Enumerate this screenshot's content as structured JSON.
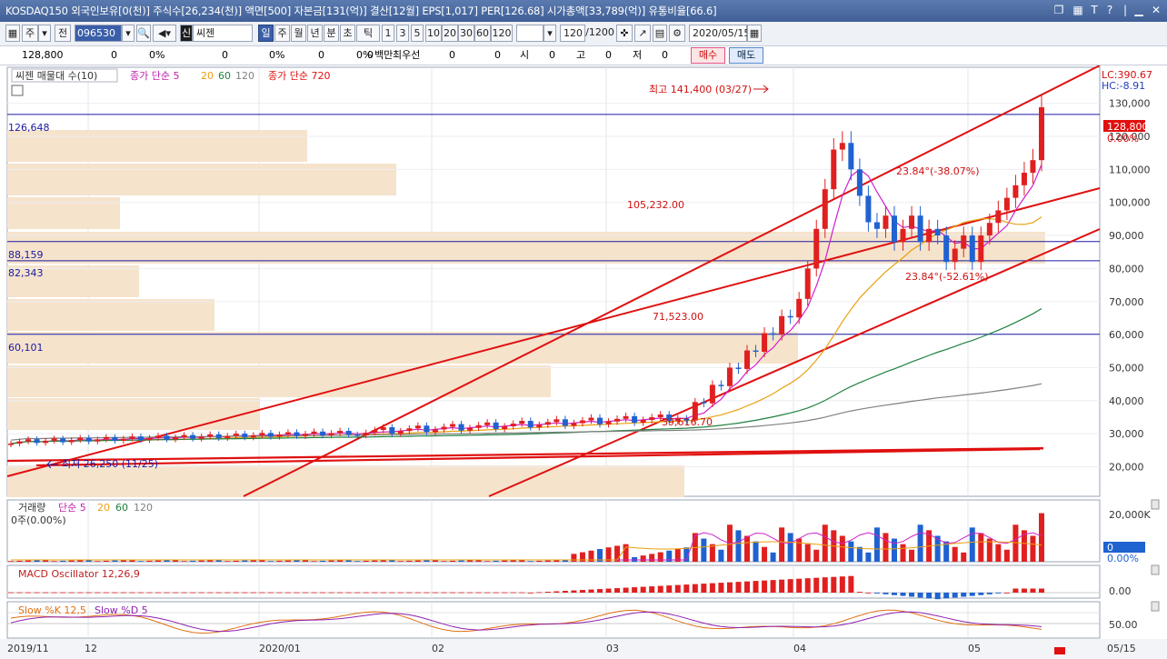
{
  "titlebar": {
    "text": "KOSDAQ150 외국인보유[0(천)] 주식수[26,234(천)] 액면[500] 자본금[131(억)] 결산[12월] EPS[1,017] PER[126.68] 시가총액[33,789(억)] 유통비율[66.6]"
  },
  "toolbar": {
    "buttons": [
      "주",
      "전"
    ],
    "code": "096530",
    "name": "씨젠",
    "name_badge": "신",
    "periods": [
      "일",
      "주",
      "월",
      "년",
      "분",
      "초",
      "틱"
    ],
    "intervals": [
      "1",
      "3",
      "5",
      "10",
      "20",
      "30",
      "60",
      "120"
    ],
    "count": "120",
    "count_total": "/1200",
    "date": "2020/05/15"
  },
  "infobar": {
    "price": "128,800",
    "v1": "0",
    "p1": "0%",
    "v2": "0",
    "p2": "0%",
    "v3": "0",
    "p3": "0%",
    "v4": "0",
    "unit": "백만",
    "best_label": "최우선",
    "v5": "0",
    "v6": "0",
    "open_label": "시",
    "v7": "0",
    "high_label": "고",
    "v8": "0",
    "low_label": "저",
    "v9": "0",
    "buy": "매수",
    "sell": "매도"
  },
  "main_chart": {
    "legend": {
      "title": "씨젠 매물대 수(10)",
      "ma_label": "종가 단순 5",
      "ma20": "20",
      "ma60": "60",
      "ma120": "120",
      "ma720": "종가 단순 720"
    },
    "lc": "LC:390.67",
    "hc": "HC:-8.91",
    "price_tag": "128,800",
    "pct_tag": "0.00%",
    "yticks": [
      "130,000",
      "120,000",
      "110,000",
      "100,000",
      "90,000",
      "80,000",
      "70,000",
      "60,000",
      "50,000",
      "40,000",
      "30,000",
      "20,000"
    ],
    "hlines": [
      "126,648",
      "88,159",
      "82,343",
      "60,101"
    ],
    "annotations": {
      "high": "최고 141,400 (03/27)",
      "low": "최저 26,250 (11/25)",
      "a1": "105,232.00",
      "a2": "71,523.00",
      "a3": "39,616.70",
      "a4": "23.84°(-38.07%)",
      "a5": "23.84°(-52.61%)"
    }
  },
  "volume_chart": {
    "legend": "거래량",
    "ma_label": "단순 5",
    "ma20": "20",
    "ma60": "60",
    "ma120": "120",
    "sub": "0주(0.00%)",
    "ytick": "20,000K",
    "tag": "0",
    "pct": "0.00%"
  },
  "macd_chart": {
    "legend": "MACD Oscillator 12,26,9",
    "ytick": "0.00"
  },
  "slow_chart": {
    "legend_k": "Slow %K 12,5",
    "legend_d": "Slow %D 5",
    "ytick": "50.00"
  },
  "xaxis": {
    "labels": [
      "2019/11",
      "12",
      "2020/01",
      "02",
      "03",
      "04",
      "05",
      "05/15"
    ]
  },
  "colors": {
    "up": "#e02020",
    "down": "#1f62d0",
    "ma5": "#d020c8",
    "ma20": "#e8a010",
    "ma60": "#208040",
    "ma120": "#808080",
    "channel": "#e01010",
    "hline": "#1a1aa0",
    "volume_profile": "#f6e3cc"
  }
}
